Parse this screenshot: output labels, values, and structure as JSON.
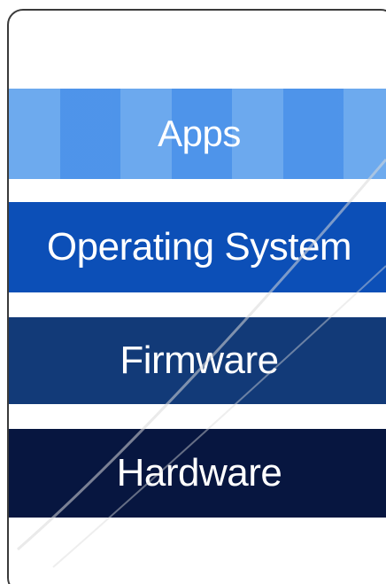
{
  "diagram": {
    "layers": [
      {
        "label": "Apps",
        "color": "#4b92ea"
      },
      {
        "label": "Operating System",
        "color": "#0c4fb7"
      },
      {
        "label": "Firmware",
        "color": "#123a78"
      },
      {
        "label": "Hardware",
        "color": "#071640"
      }
    ]
  }
}
